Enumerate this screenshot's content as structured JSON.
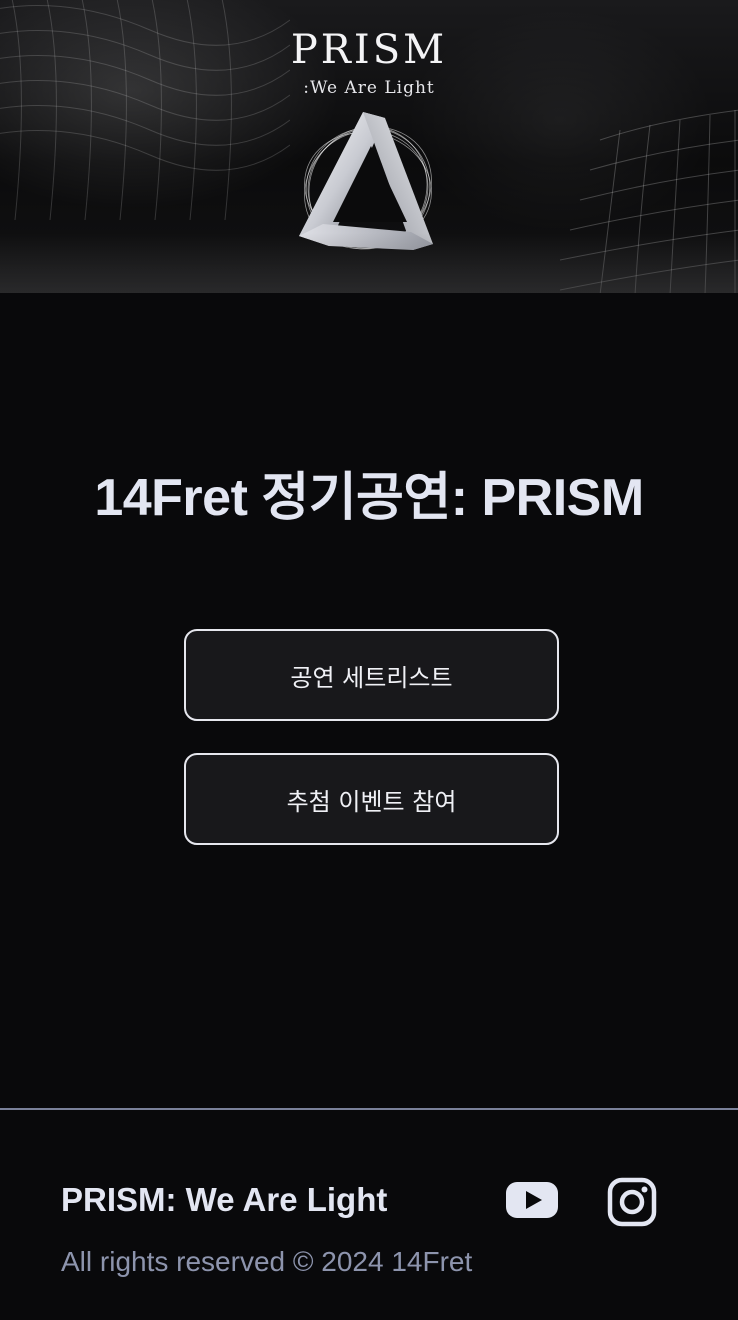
{
  "header": {
    "logo_title": "PRISM",
    "logo_subtitle": ":We Are Light"
  },
  "main": {
    "title": "14Fret 정기공연: PRISM",
    "buttons": {
      "setlist_label": "공연 세트리스트",
      "raffle_label": "추첨 이벤트 참여"
    }
  },
  "footer": {
    "title": "PRISM: We Are Light",
    "copyright": "All rights reserved © 2024 14Fret",
    "social": [
      {
        "icon": "youtube-icon"
      },
      {
        "icon": "instagram-icon"
      }
    ]
  },
  "colors": {
    "background": "#09090b",
    "button_bg": "#18181b",
    "button_border": "#e6e7ee",
    "title_text": "#e3e6f2",
    "muted_text": "#8d94ad",
    "divider": "#7a819a"
  }
}
